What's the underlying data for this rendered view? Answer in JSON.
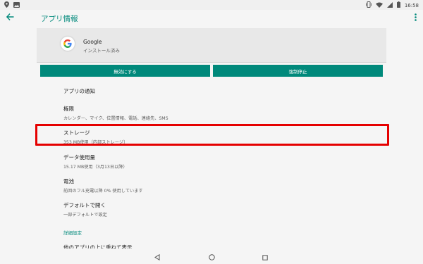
{
  "status_bar": {
    "time": "16:58"
  },
  "app_bar": {
    "title": "アプリ情報"
  },
  "app": {
    "name": "Google",
    "install_status": "インストール済み"
  },
  "buttons": {
    "disable": "無効にする",
    "force_stop": "強制停止"
  },
  "settings": [
    {
      "title": "アプリの通知",
      "subtitle": ""
    },
    {
      "title": "権限",
      "subtitle": "カレンダー、マイク、位置情報、電話、連絡先、SMS"
    },
    {
      "title": "ストレージ",
      "subtitle": "353 MB使用（内部ストレージ）",
      "highlighted": true
    },
    {
      "title": "データ使用量",
      "subtitle": "15.17 MB使用（3月13日以降）"
    },
    {
      "title": "電池",
      "subtitle": "前回のフル充電以降 0% 使用しています"
    },
    {
      "title": "デフォルトで開く",
      "subtitle": "一部デフォルトで設定"
    }
  ],
  "advanced": {
    "section_label": "詳細設定",
    "items": [
      {
        "title": "他のアプリの上に重ねて表示"
      }
    ]
  },
  "colors": {
    "accent": "#00897b",
    "highlight": "#e50000"
  },
  "icons": {
    "back": "arrow-left-icon",
    "overflow": "more-vert-icon",
    "app_logo": "google-logo-icon"
  }
}
